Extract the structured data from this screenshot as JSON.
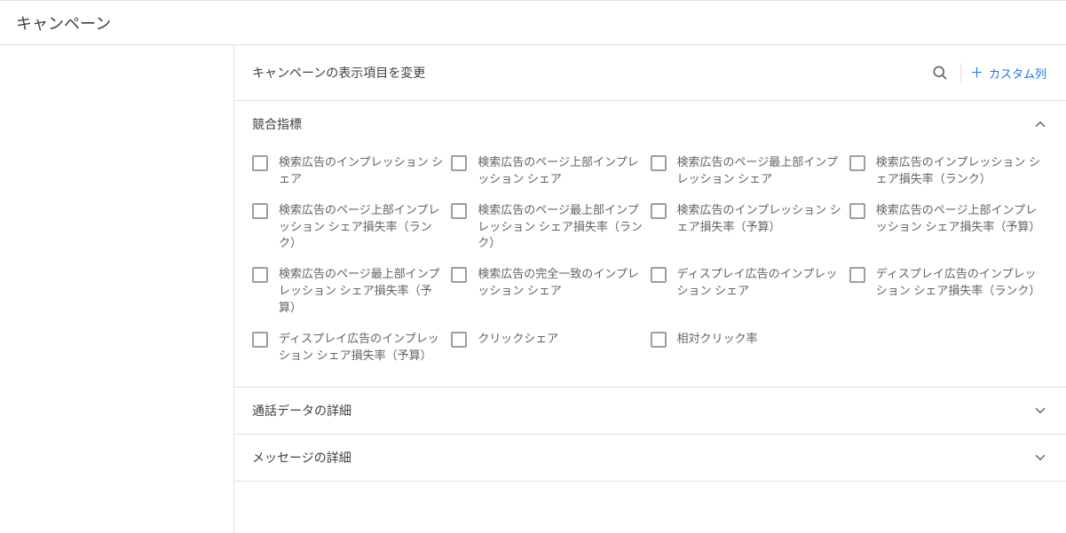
{
  "header": {
    "title": "キャンペーン"
  },
  "panel": {
    "title": "キャンペーンの表示項目を変更",
    "custom_column_label": "カスタム列"
  },
  "sections": {
    "competitive": {
      "label": "競合指標",
      "expanded": true,
      "items": [
        "検索広告のインプレッション シェア",
        "検索広告のページ上部インプレッション シェア",
        "検索広告のページ最上部インプレッション シェア",
        "検索広告のインプレッション シェア損失率（ランク）",
        "検索広告のページ上部インプレッション シェア損失率（ランク）",
        "検索広告のページ最上部インプレッション シェア損失率（ランク）",
        "検索広告のインプレッション シェア損失率（予算）",
        "検索広告のページ上部インプレッション シェア損失率（予算）",
        "検索広告のページ最上部インプレッション シェア損失率（予算）",
        "検索広告の完全一致のインプレッション シェア",
        "ディスプレイ広告のインプレッション シェア",
        "ディスプレイ広告のインプレッション シェア損失率（ランク）",
        "ディスプレイ広告のインプレッション シェア損失率（予算）",
        "クリックシェア",
        "相対クリック率"
      ]
    },
    "call_details": {
      "label": "通話データの詳細",
      "expanded": false
    },
    "message_details": {
      "label": "メッセージの詳細",
      "expanded": false
    }
  }
}
